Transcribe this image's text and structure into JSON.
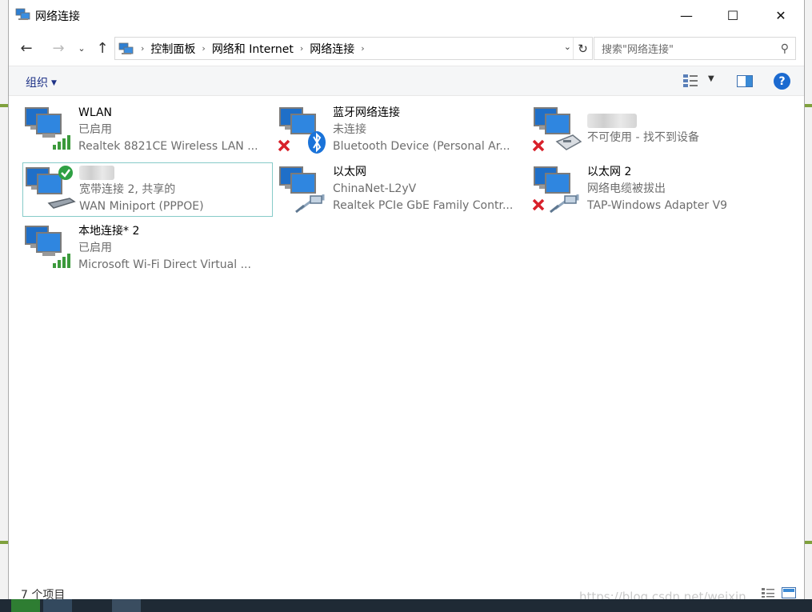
{
  "window": {
    "title": "网络连接",
    "minimize_glyph": "—",
    "maximize_glyph": "☐",
    "close_glyph": "✕"
  },
  "nav": {
    "back_glyph": "←",
    "forward_glyph": "→",
    "recent_glyph": "⌄",
    "up_glyph": "↑",
    "breadcrumbs": [
      "控制面板",
      "网络和 Internet",
      "网络连接"
    ],
    "separator": "›",
    "refresh_glyph": "↻",
    "search_placeholder": "搜索\"网络连接\""
  },
  "toolbar": {
    "organize_label": "组织",
    "help_label": "?"
  },
  "connections": [
    {
      "name": "WLAN",
      "status": "已启用",
      "device": "Realtek 8821CE Wireless LAN ...",
      "icon": "wifi-signal-icon",
      "overlay": "none"
    },
    {
      "name": "蓝牙网络连接",
      "status": "未连接",
      "device": "Bluetooth Device (Personal Ar...",
      "icon": "bluetooth-icon",
      "overlay": "red-x"
    },
    {
      "name": "",
      "status": "不可使用 - 找不到设备",
      "device": "",
      "icon": "modem-icon",
      "overlay": "red-x"
    },
    {
      "name": "",
      "status": "宽带连接 2, 共享的",
      "device": "WAN Miniport (PPPOE)",
      "icon": "miniport-icon",
      "overlay": "green-check"
    },
    {
      "name": "以太网",
      "status": "ChinaNet-L2yV",
      "device": "Realtek PCIe GbE Family Contr...",
      "icon": "ethernet-cable-icon",
      "overlay": "none"
    },
    {
      "name": "以太网 2",
      "status": "网络电缆被拔出",
      "device": "TAP-Windows Adapter V9",
      "icon": "ethernet-cable-icon",
      "overlay": "red-x"
    },
    {
      "name": "本地连接* 2",
      "status": "已启用",
      "device": "Microsoft Wi-Fi Direct Virtual ...",
      "icon": "wifi-signal-icon",
      "overlay": "none"
    }
  ],
  "status_bar": {
    "item_count": "7 个项目"
  },
  "watermark": "https://blog.csdn.net/weixin_"
}
